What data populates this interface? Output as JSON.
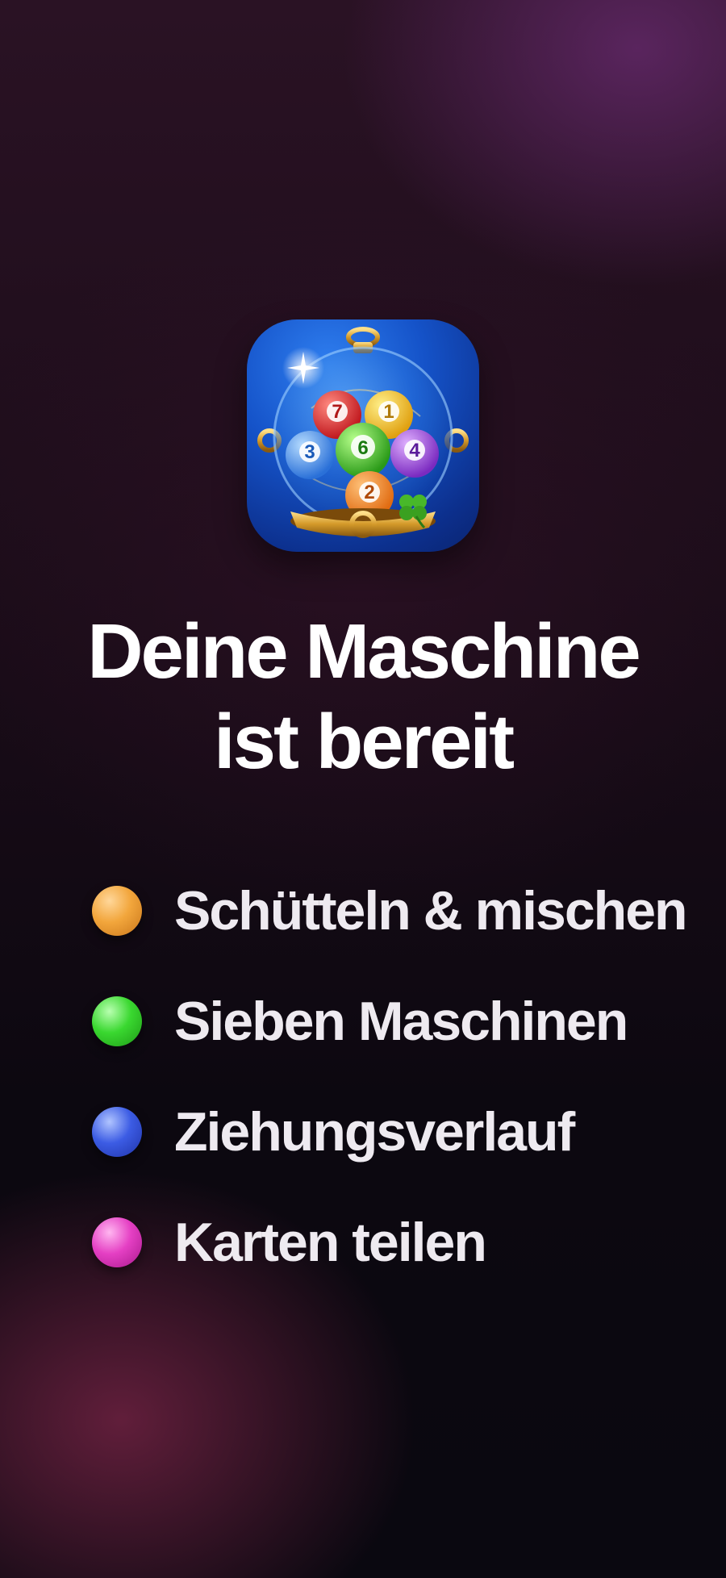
{
  "app_icon": {
    "icon": "lottery-globe-icon",
    "balls": [
      "7",
      "1",
      "3",
      "6",
      "4",
      "2"
    ]
  },
  "title": {
    "line1": "Deine Maschine",
    "line2": "ist bereit"
  },
  "features": [
    {
      "label": "Schütteln & mischen",
      "icon": "orange-ball-icon",
      "color": "#f0a13a"
    },
    {
      "label": "Sieben Maschinen",
      "icon": "green-ball-icon",
      "color": "#35d42c"
    },
    {
      "label": "Ziehungsverlauf",
      "icon": "blue-ball-icon",
      "color": "#3a57e0"
    },
    {
      "label": "Karten teilen",
      "icon": "pink-ball-icon",
      "color": "#e23cc0"
    }
  ]
}
